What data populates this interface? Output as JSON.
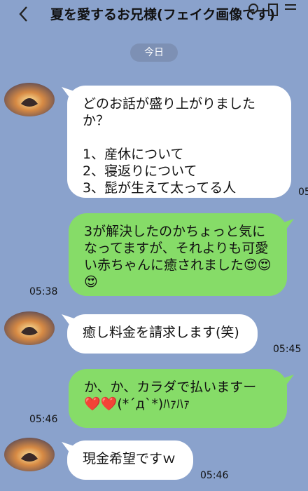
{
  "header": {
    "title": "夏を愛するお兄様(フェイク画像です)"
  },
  "date_pill": "今日",
  "messages": [
    {
      "side": "in",
      "text": "どのお話が盛り上がりましたか？\n\n1、産休について\n2、寝返りについて\n3、髭が生えて太ってる人",
      "time": "05"
    },
    {
      "side": "out",
      "text": "3が解決したのかちょっと気になってますが、それよりも可愛い赤ちゃんに癒されました😍😍😍",
      "time": "05:38"
    },
    {
      "side": "in",
      "text": "癒し料金を請求します(笑)",
      "time": "05:45"
    },
    {
      "side": "out",
      "text": "か、か、カラダで払いますー❤️❤️(*´д`*)ﾊｧﾊｧ",
      "time": "05:46"
    },
    {
      "side": "in",
      "text": "現金希望ですｗ",
      "time": "05:46"
    }
  ],
  "colors": {
    "background": "#8aa2cc",
    "incoming": "#ffffff",
    "outgoing": "#86dc68"
  }
}
